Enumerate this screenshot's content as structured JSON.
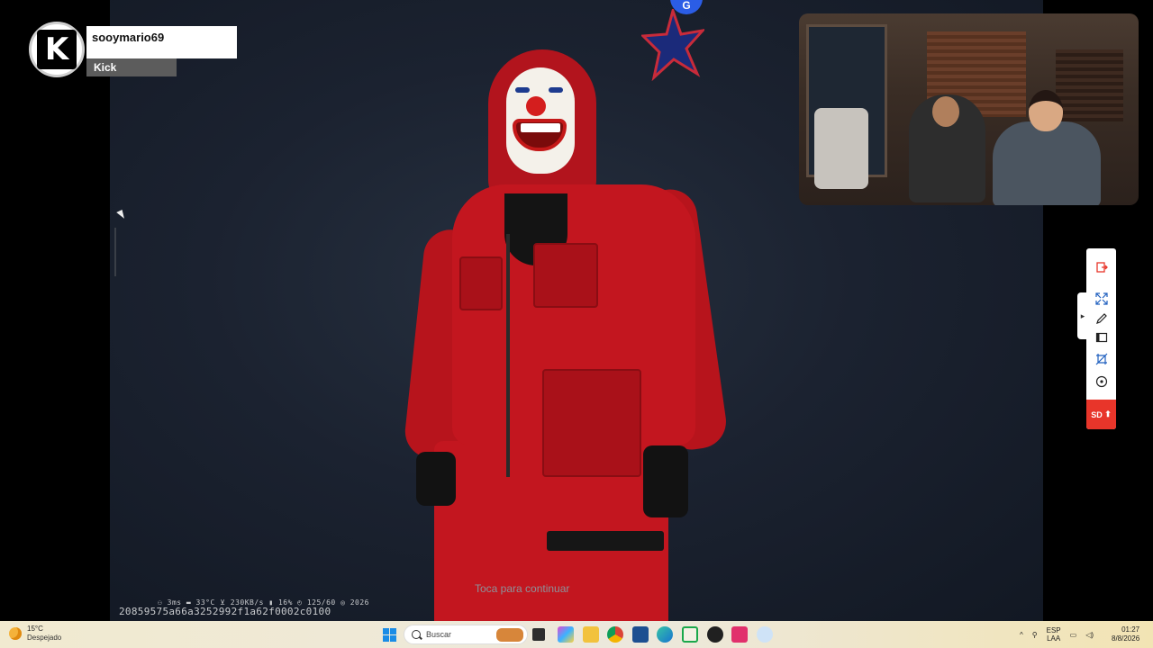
{
  "streamer_badge": {
    "username": "sooymario69",
    "platform": "Kick",
    "avatar_letter": "K"
  },
  "game": {
    "prompt": "Toca para continuar",
    "hud_stats": "⚇ 3ms  ▬ 33°C  ⊻ 230KB/s  ▮ 16%  ◴ 125/60  ◎ 2026",
    "session_id": "20859575a66a3252992f1a62f0002c0100",
    "top_icon": "G"
  },
  "tool_panel": {
    "tools": [
      "exit-icon",
      "expand-icon",
      "pen-icon",
      "panel-icon",
      "crop-icon",
      "record-icon"
    ],
    "quality_label": "SD",
    "accent": "#e8352a"
  },
  "taskbar": {
    "weather_temp": "15°C",
    "weather_desc": "Despejado",
    "search_placeholder": "Buscar",
    "lang_top": "ESP",
    "lang_bottom": "LAA",
    "time": "01:27",
    "date": "8/8/2026"
  }
}
